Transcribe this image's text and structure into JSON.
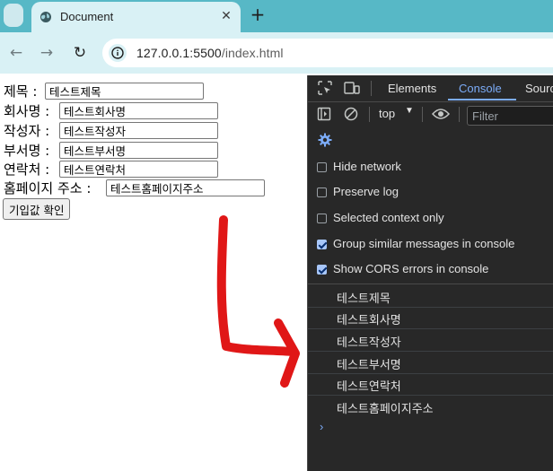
{
  "browser": {
    "tab": {
      "title": "Document"
    },
    "address_bar": {
      "host": "127.0.0.1:5500",
      "path": "/index.html"
    }
  },
  "form": {
    "fields": [
      {
        "label": "제목 :",
        "value": "테스트제목"
      },
      {
        "label": "회사명 :",
        "value": "테스트회사명"
      },
      {
        "label": "작성자 :",
        "value": "테스트작성자"
      },
      {
        "label": "부서명 :",
        "value": "테스트부서명"
      },
      {
        "label": "연락처 :",
        "value": "테스트연락처"
      },
      {
        "label": "홈페이지 주소 :",
        "value": "테스트홈페이지주소"
      }
    ],
    "submit_label": "기입값 확인"
  },
  "devtools": {
    "tabs": [
      "Elements",
      "Console",
      "Sourc"
    ],
    "active_tab": "Console",
    "context": "top",
    "filter_placeholder": "Filter",
    "options": [
      {
        "label": "Hide network",
        "checked": false
      },
      {
        "label": "Preserve log",
        "checked": false
      },
      {
        "label": "Selected context only",
        "checked": false
      },
      {
        "label": "Group similar messages in console",
        "checked": true
      },
      {
        "label": "Show CORS errors in console",
        "checked": true
      }
    ],
    "console_logs": [
      "테스트제목",
      "테스트회사명",
      "테스트작성자",
      "테스트부서명",
      "테스트연락처",
      "테스트홈페이지주소"
    ],
    "prompt": "›"
  },
  "colors": {
    "annotation_arrow": "#e01717",
    "tab_strip": "#57b8c6",
    "accent": "#7cacf8"
  }
}
